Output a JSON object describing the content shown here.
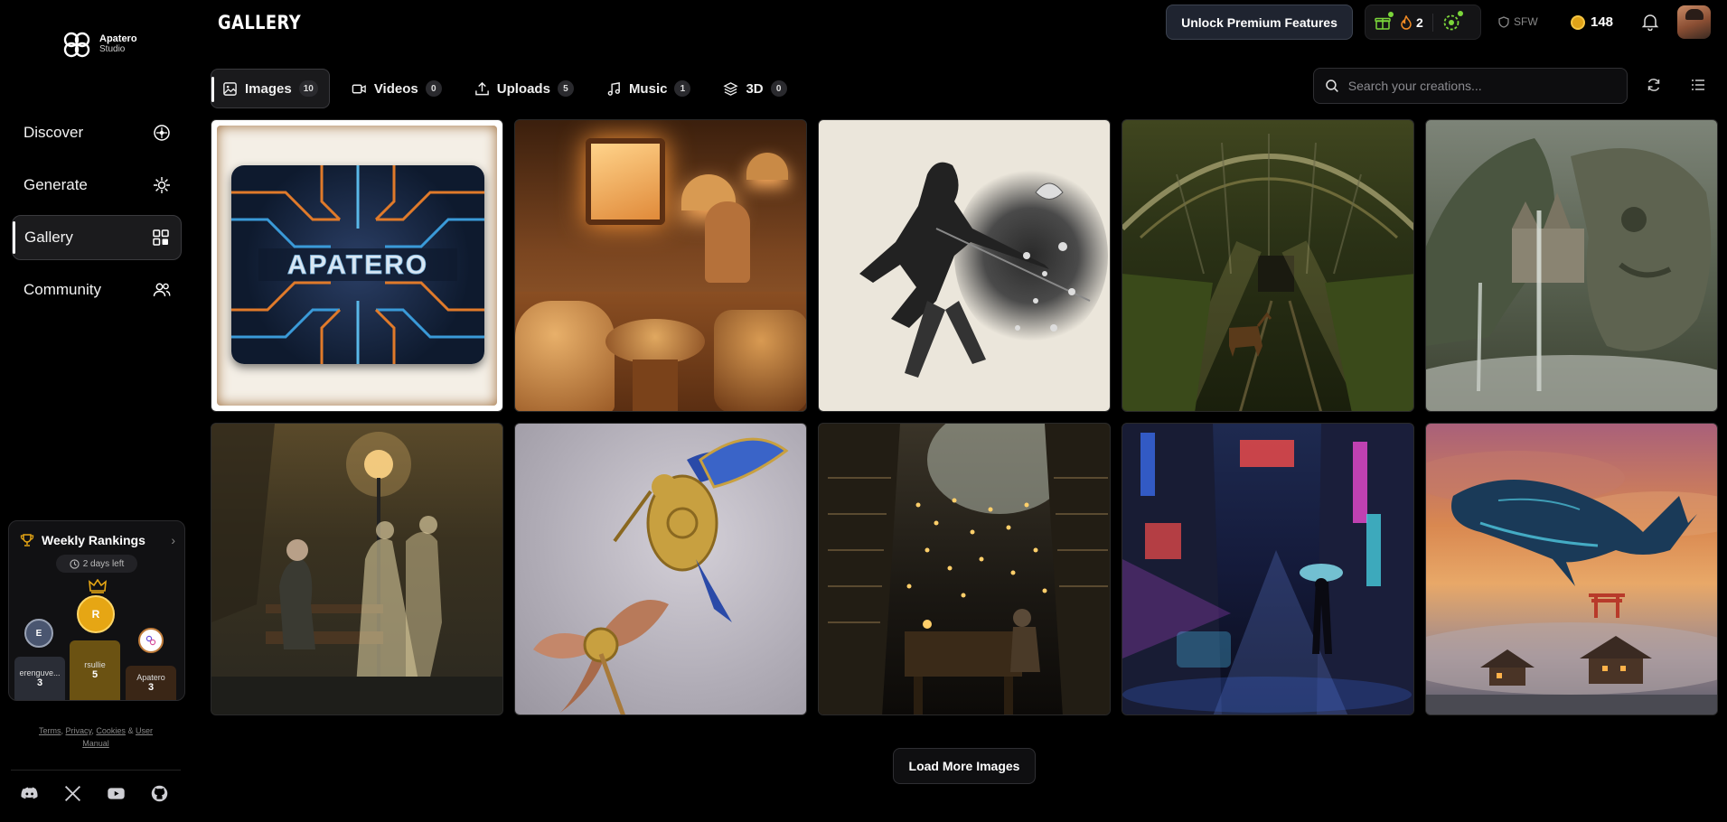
{
  "brand": {
    "name": "Apatero",
    "sub": "Studio"
  },
  "header": {
    "title": "GALLERY",
    "premium_label": "Unlock Premium Features",
    "streak_count": "2",
    "sfw_label": "SFW",
    "credits": "148"
  },
  "sidebar": {
    "items": [
      {
        "label": "Discover",
        "icon": "compass-icon"
      },
      {
        "label": "Generate",
        "icon": "sparkle-icon"
      },
      {
        "label": "Gallery",
        "icon": "grid-icon",
        "active": true
      },
      {
        "label": "Community",
        "icon": "users-icon"
      }
    ],
    "rankings": {
      "title": "Weekly Rankings",
      "days_left": "2 days left",
      "podium": [
        {
          "place": 2,
          "initial": "E",
          "name": "erenguve...",
          "score": "3"
        },
        {
          "place": 1,
          "initial": "R",
          "name": "rsullie",
          "score": "5"
        },
        {
          "place": 3,
          "initial": "",
          "name": "Apatero",
          "score": "3"
        }
      ]
    },
    "legal": {
      "terms": "Terms",
      "privacy": "Privacy",
      "cookies": "Cookies",
      "amp": "&",
      "manual": "User Manual",
      "comma": ","
    }
  },
  "tabs": [
    {
      "label": "Images",
      "count": "10",
      "icon": "image-icon",
      "active": true
    },
    {
      "label": "Videos",
      "count": "0",
      "icon": "video-icon"
    },
    {
      "label": "Uploads",
      "count": "5",
      "icon": "upload-icon"
    },
    {
      "label": "Music",
      "count": "1",
      "icon": "music-icon"
    },
    {
      "label": "3D",
      "count": "0",
      "icon": "layers-icon"
    }
  ],
  "search": {
    "placeholder": "Search your creations..."
  },
  "gallery": {
    "images": [
      {
        "subject": "Apatero circuit logo",
        "colors": [
          "#f4efe6",
          "#1a2b45"
        ]
      },
      {
        "subject": "bread cafe",
        "colors": [
          "#6b3a17",
          "#d89a52"
        ]
      },
      {
        "subject": "ink samurai",
        "colors": [
          "#ebe6db",
          "#2a2a2a"
        ]
      },
      {
        "subject": "overgrown train station with deer",
        "colors": [
          "#2b3216",
          "#b8a35a"
        ]
      },
      {
        "subject": "stone giant castle waterfall",
        "colors": [
          "#3d4230",
          "#8d9a87"
        ]
      },
      {
        "subject": "elderly man and ghostly dancers in park",
        "colors": [
          "#2a2a20",
          "#a88a52"
        ]
      },
      {
        "subject": "mechanical hummingbird",
        "colors": [
          "#b7b3bd",
          "#3a58b8"
        ]
      },
      {
        "subject": "candlelit library cave",
        "colors": [
          "#1a1712",
          "#8a7550"
        ]
      },
      {
        "subject": "neon cyberpunk street",
        "colors": [
          "#141a3a",
          "#4a8ad8"
        ]
      },
      {
        "subject": "flying glowing whale",
        "colors": [
          "#d98850",
          "#49b8d0"
        ]
      }
    ],
    "load_more_label": "Load More Images"
  },
  "colors": {
    "accent_gold": "#e6a614",
    "green_status": "#7bd63a",
    "bg": "#000000"
  }
}
